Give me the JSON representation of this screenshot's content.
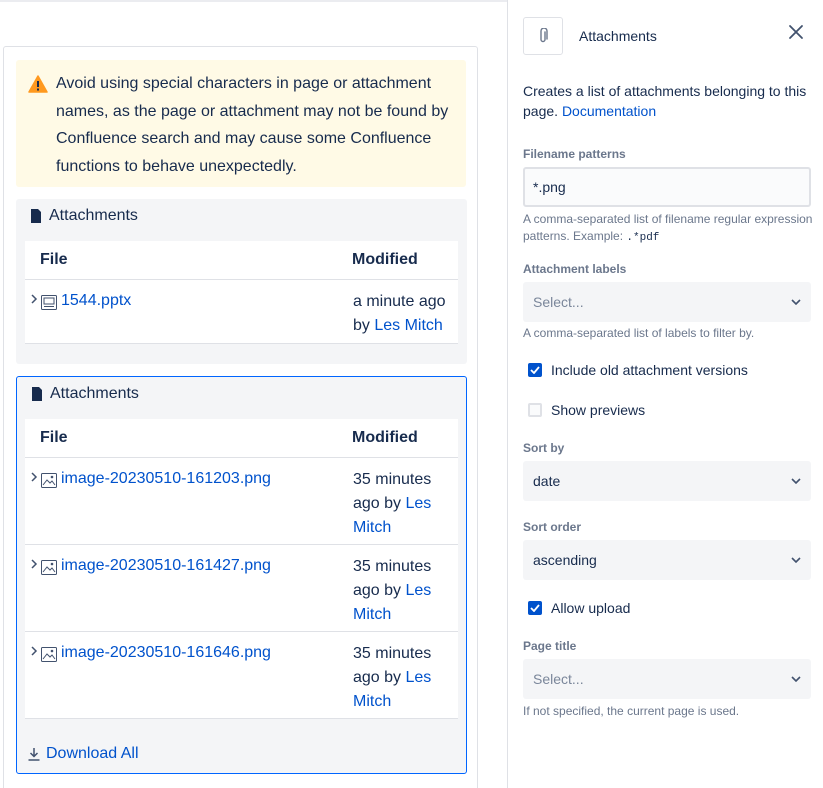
{
  "warning": {
    "icon": "warning-icon",
    "lines": [
      "Avoid using special characters in page or attachment",
      "names, as the page or attachment may not be found by",
      "Confluence search and may cause some Confluence",
      "functions to behave unexpectedly."
    ]
  },
  "macro1": {
    "title": "Attachments",
    "col_file": "File",
    "col_modified": "Modified",
    "rows": [
      {
        "file": "1544.pptx",
        "mod_line1": "a minute ago",
        "mod_by": "by ",
        "mod_user": "Les Mitch"
      }
    ]
  },
  "macro2": {
    "title": "Attachments",
    "col_file": "File",
    "col_modified": "Modified",
    "rows": [
      {
        "file": "image-20230510-161203.png",
        "mod_line1": "35 minutes",
        "mod_line2": "ago by ",
        "mod_user1": "Les",
        "mod_user2": "Mitch"
      },
      {
        "file": "image-20230510-161427.png",
        "mod_line1": "35 minutes",
        "mod_line2": "ago by ",
        "mod_user1": "Les",
        "mod_user2": "Mitch"
      },
      {
        "file": "image-20230510-161646.png",
        "mod_line1": "35 minutes",
        "mod_line2": "ago by ",
        "mod_user1": "Les",
        "mod_user2": "Mitch"
      }
    ],
    "download_label": "Download All"
  },
  "panel": {
    "title": "Attachments",
    "description": "Creates a list of attachments belonging to this page. ",
    "doc_link": "Documentation",
    "filename_patterns": {
      "label": "Filename patterns",
      "value": "*.png",
      "help_text": "A comma-separated list of filename regular expression patterns. Example: ",
      "help_code": ".*pdf"
    },
    "attachment_labels": {
      "label": "Attachment labels",
      "placeholder": "Select...",
      "help_text": "A comma-separated list of labels to filter by."
    },
    "include_old_versions": {
      "label": "Include old attachment versions",
      "checked": true
    },
    "show_previews": {
      "label": "Show previews",
      "checked": false
    },
    "sort_by": {
      "label": "Sort by",
      "value": "date"
    },
    "sort_order": {
      "label": "Sort order",
      "value": "ascending"
    },
    "allow_upload": {
      "label": "Allow upload",
      "checked": true
    },
    "page_title": {
      "label": "Page title",
      "placeholder": "Select...",
      "help_text": "If not specified, the current page is used."
    }
  },
  "colors": {
    "link": "#0052cc",
    "warning_bg": "#fffae6",
    "warning_icon": "#ff991f",
    "checkbox_on": "#0052cc",
    "selection_border": "#0065ff"
  }
}
